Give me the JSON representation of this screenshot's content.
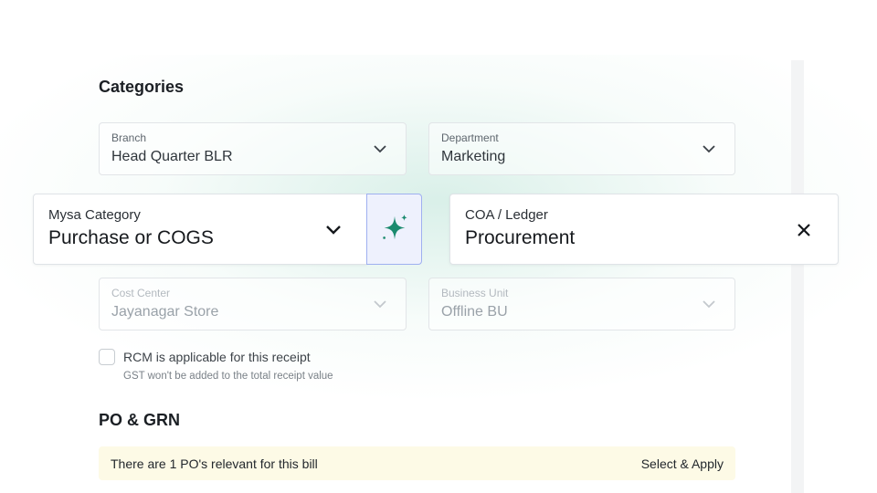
{
  "categories": {
    "heading": "Categories",
    "branch": {
      "label": "Branch",
      "value": "Head Quarter BLR"
    },
    "department": {
      "label": "Department",
      "value": "Marketing"
    },
    "mysa_category": {
      "label": "Mysa Category",
      "value": "Purchase or COGS"
    },
    "coa_ledger": {
      "label": "COA / Ledger",
      "value": "Procurement"
    },
    "cost_center": {
      "label": "Cost Center",
      "value": "Jayanagar Store"
    },
    "business_unit": {
      "label": "Business Unit",
      "value": "Offline BU"
    },
    "rcm": {
      "label": "RCM is applicable for this receipt",
      "hint": "GST won't be added to the total receipt value",
      "checked": false
    }
  },
  "po_grn": {
    "heading": "PO & GRN",
    "banner_text": "There are 1 PO's relevant for this bill",
    "action_label": "Select & Apply"
  },
  "icons": {
    "dropdown": "chevron-down-icon",
    "clear": "close-icon",
    "ai_suggest": "sparkle-icon"
  },
  "colors": {
    "sparkle": "#1a8a6e",
    "ai_button_border": "#9fb0f0",
    "ai_button_bg": "#eef1fd",
    "banner_bg": "#fdfae6",
    "glow": "#bfe6d7"
  }
}
